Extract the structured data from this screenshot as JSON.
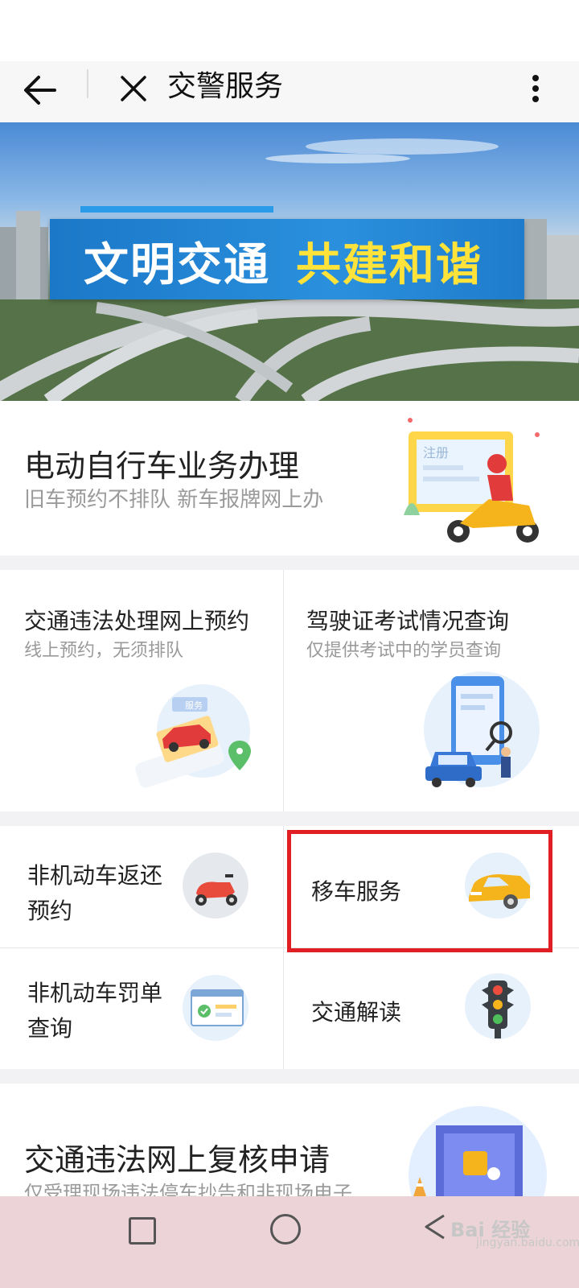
{
  "navbar": {
    "title": "交警服务",
    "back_icon": "arrow-left-icon",
    "close_icon": "close-icon",
    "more_icon": "more-vertical-icon"
  },
  "banner": {
    "text_white": "文明交通",
    "text_yellow": "共建和谐",
    "accent_blue": "#1f80d0",
    "accent_yellow": "#ffe23a"
  },
  "ebike_card": {
    "title": "电动自行车业务办理",
    "subtitle": "旧车预约不排队 新车报牌网上办",
    "illustration_label": "注册"
  },
  "services_row1": [
    {
      "title": "交通违法处理网上预约",
      "subtitle": "线上预约，无须排队",
      "illustration_label": "服务"
    },
    {
      "title": "驾驶证考试情况查询",
      "subtitle": "仅提供考试中的学员查询"
    }
  ],
  "services_row2": [
    {
      "title_line1": "非机动车返还",
      "title_line2": "预约",
      "icon": "scooter-icon"
    },
    {
      "title": "移车服务",
      "icon": "car-icon"
    },
    {
      "title_line1": "非机动车罚单",
      "title_line2": "查询",
      "icon": "document-check-icon"
    },
    {
      "title": "交通解读",
      "icon": "traffic-light-icon"
    }
  ],
  "review_card": {
    "title": "交通违法网上复核申请",
    "subtitle": "仅受理现场违法停车抄告和非现场电子"
  },
  "system_nav": {
    "recent_icon": "square-icon",
    "home_icon": "circle-icon",
    "back_icon": "triangle-back-icon"
  },
  "watermark": {
    "text": "Bai 经验",
    "sub": "jingyan.baidu.com"
  },
  "highlight_color": "#e01e24"
}
